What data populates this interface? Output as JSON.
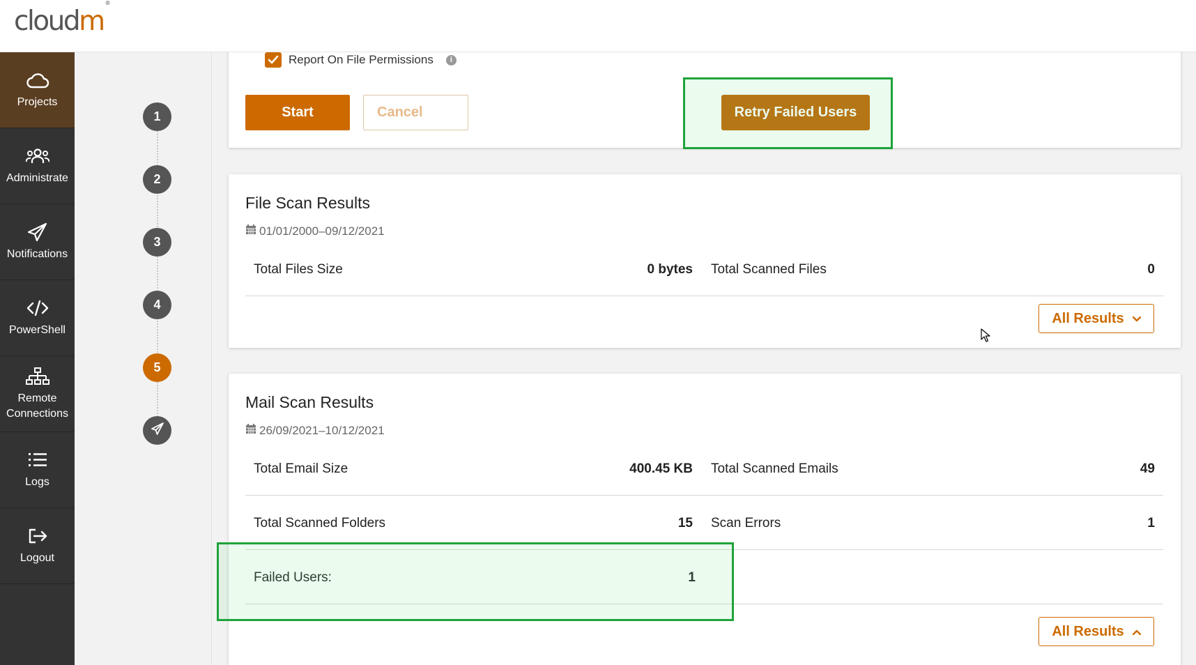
{
  "app": {
    "logo_text": "cloud",
    "logo_accent": "m",
    "logo_mark": "®"
  },
  "sidebar": {
    "items": [
      {
        "label": "Projects",
        "icon": "cloud-icon",
        "active": true
      },
      {
        "label": "Administrate",
        "icon": "users-icon"
      },
      {
        "label": "Notifications",
        "icon": "paper-plane-icon"
      },
      {
        "label": "PowerShell",
        "icon": "code-icon"
      },
      {
        "label": "Remote Connections",
        "icon": "sitemap-icon"
      },
      {
        "label": "Logs",
        "icon": "list-icon"
      },
      {
        "label": "Logout",
        "icon": "sign-out-icon"
      }
    ]
  },
  "steps": [
    "1",
    "2",
    "3",
    "4",
    "5"
  ],
  "active_step": "5",
  "options": {
    "report_permissions_label": "Report On File Permissions",
    "report_permissions_checked": true,
    "info_glyph": "i"
  },
  "actions": {
    "start_label": "Start",
    "cancel_label": "Cancel",
    "retry_label": "Retry Failed Users"
  },
  "file_scan": {
    "title": "File Scan Results",
    "date_range": "01/01/2000–09/12/2021",
    "rows": [
      {
        "label": "Total Files Size",
        "value": "0 bytes",
        "label2": "Total Scanned Files",
        "value2": "0"
      }
    ],
    "results_label": "All Results"
  },
  "mail_scan": {
    "title": "Mail Scan Results",
    "date_range": "26/09/2021–10/12/2021",
    "rows": [
      {
        "label": "Total Email Size",
        "value": "400.45 KB",
        "label2": "Total Scanned Emails",
        "value2": "49"
      },
      {
        "label": "Total Scanned Folders",
        "value": "15",
        "label2": "Scan Errors",
        "value2": "1"
      },
      {
        "label": "Failed Users:",
        "value": "1"
      }
    ],
    "results_label": "All Results"
  },
  "colors": {
    "accent": "#cc6a00",
    "sidebar_bg": "#333333",
    "highlight": "#1fa33a"
  }
}
